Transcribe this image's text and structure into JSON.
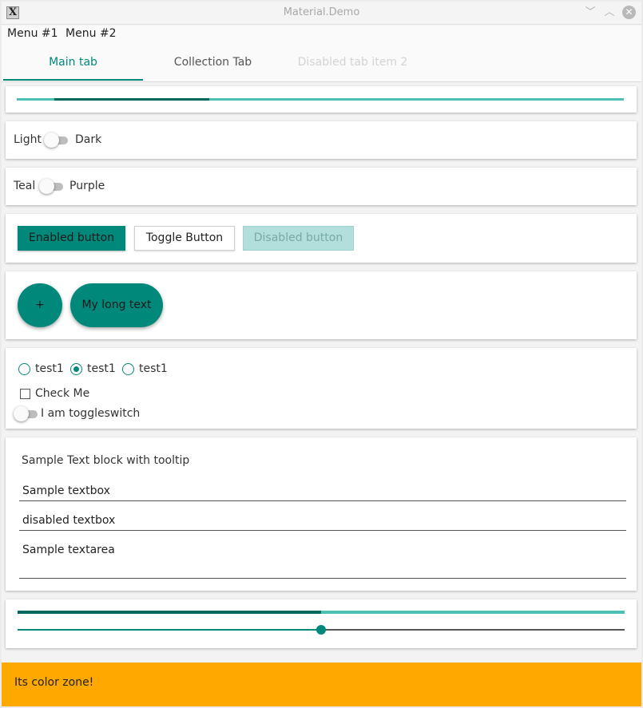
{
  "window": {
    "title": "Material.Demo",
    "app_icon_glyph": "X",
    "minimize_glyph": "﹀",
    "maximize_glyph": "︿",
    "close_glyph": "✕"
  },
  "menu": {
    "items": [
      {
        "label": "Menu #1"
      },
      {
        "label": "Menu #2"
      }
    ]
  },
  "tabs": [
    {
      "label": "Main tab",
      "state": "active"
    },
    {
      "label": "Collection Tab",
      "state": "normal"
    },
    {
      "label": "Disabled tab item 2",
      "state": "disabled"
    }
  ],
  "progress": {
    "indeterminate": true
  },
  "theme_switch": {
    "left_label": "Light",
    "right_label": "Dark",
    "checked": false
  },
  "color_switch": {
    "left_label": "Teal",
    "right_label": "Purple",
    "checked": false
  },
  "buttons": {
    "enabled": "Enabled button",
    "toggle": "Toggle Button",
    "disabled": "Disabled button"
  },
  "fabs": {
    "plus": "+",
    "long": "My long text"
  },
  "radios": [
    {
      "label": "test1",
      "checked": false
    },
    {
      "label": "test1",
      "checked": true
    },
    {
      "label": "test1",
      "checked": false
    }
  ],
  "checkbox": {
    "label": "Check Me",
    "checked": false
  },
  "toggleswitch": {
    "label": "I am toggleswitch",
    "checked": false
  },
  "text_section": {
    "tooltip_text": "Sample Text block with tooltip",
    "textbox": "Sample textbox",
    "disabled_textbox": "disabled textbox",
    "textarea": "Sample textarea"
  },
  "slider_section": {
    "progress_value": 0.5,
    "slider_value": 0.5
  },
  "color_zone": {
    "text": "Its color zone!",
    "color": "#ffa800"
  },
  "colors": {
    "accent": "#00897b",
    "accent_light": "#4dc0b5",
    "accent_dark": "#00695c"
  }
}
